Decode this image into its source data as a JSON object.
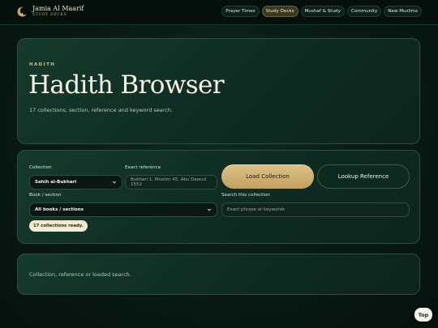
{
  "brand": {
    "name": "Jamia Al Maarif",
    "sub": "STUDY DECKS"
  },
  "nav": {
    "items": [
      {
        "label": "Prayer Times"
      },
      {
        "label": "Study Decks"
      },
      {
        "label": "Mushaf & Study"
      },
      {
        "label": "Community"
      },
      {
        "label": "New Muslims"
      }
    ],
    "active": "Study Decks"
  },
  "hero": {
    "eyebrow": "HADITH",
    "title": "Hadith Browser",
    "subtitle": "17 collections, section, reference and keyword search."
  },
  "form": {
    "collection_label": "Collection",
    "collection_value": "Sahih al-Bukhari",
    "reference_label": "Exact reference",
    "reference_placeholder": "Bukhari 1, Muslim 45, Abu Dawud 1552",
    "load_button": "Load Collection",
    "lookup_button": "Lookup Reference",
    "book_label": "Book / section",
    "book_value": "All books / sections",
    "search_label": "Search this collection",
    "search_placeholder": "Exact phrase or keywords",
    "status": "17 collections ready."
  },
  "results": {
    "text": "Collection, reference or loaded search."
  },
  "top_button": "Top",
  "colors": {
    "accent_gold": "#d4b775",
    "background": "#091a14",
    "panel": "#133528"
  }
}
